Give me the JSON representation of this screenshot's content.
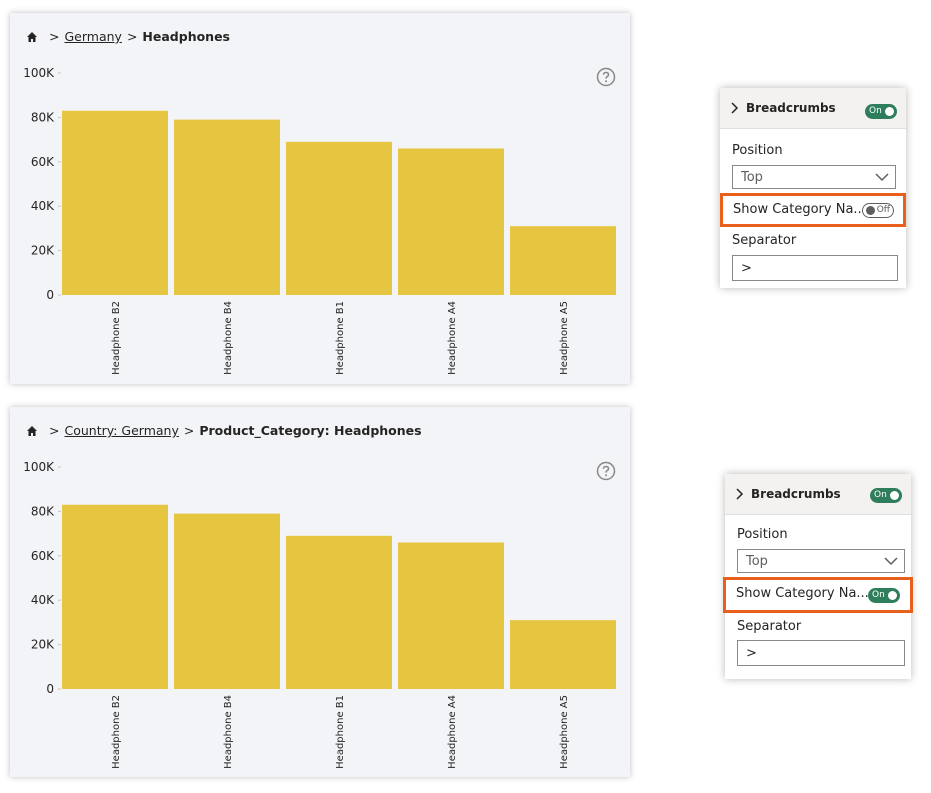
{
  "visuals": [
    {
      "breadcrumb": {
        "link_label": "Germany",
        "separator": ">",
        "current_label": "Headphones"
      }
    },
    {
      "breadcrumb": {
        "link_label": "Country: Germany",
        "separator": ">",
        "current_label": "Product_Category: Headphones"
      }
    }
  ],
  "chart_data": [
    {
      "type": "bar",
      "categories": [
        "Headphone B2",
        "Headphone B4",
        "Headphone B1",
        "Headphone A4",
        "Headphone A5"
      ],
      "values": [
        83000,
        79000,
        69000,
        66000,
        31000
      ],
      "ylim": [
        0,
        100000
      ],
      "yticks": [
        "0",
        "20K",
        "40K",
        "60K",
        "80K",
        "100K"
      ],
      "bar_color": "#e6c641"
    },
    {
      "type": "bar",
      "categories": [
        "Headphone B2",
        "Headphone B4",
        "Headphone B1",
        "Headphone A4",
        "Headphone A5"
      ],
      "values": [
        83000,
        79000,
        69000,
        66000,
        31000
      ],
      "ylim": [
        0,
        100000
      ],
      "yticks": [
        "0",
        "20K",
        "40K",
        "60K",
        "80K",
        "100K"
      ],
      "bar_color": "#e6c641"
    }
  ],
  "panes": [
    {
      "title": "Breadcrumbs",
      "toggle_label": "On",
      "position_label": "Position",
      "position_value": "Top",
      "category_label": "Show Category Na...",
      "category_toggle": "Off",
      "separator_label": "Separator",
      "separator_value": ">"
    },
    {
      "title": "Breadcrumbs",
      "toggle_label": "On",
      "position_label": "Position",
      "position_value": "Top",
      "category_label": "Show Category Na...",
      "category_toggle": "On",
      "separator_label": "Separator",
      "separator_value": ">"
    }
  ],
  "colors": {
    "accent_highlight": "#e8601c",
    "toggle_on": "#2e7d5b",
    "bar": "#e6c641"
  },
  "icons": {
    "home": "home-icon",
    "help": "help-icon",
    "chevron_right": "chevron-right-icon",
    "chevron_down": "chevron-down-icon"
  }
}
